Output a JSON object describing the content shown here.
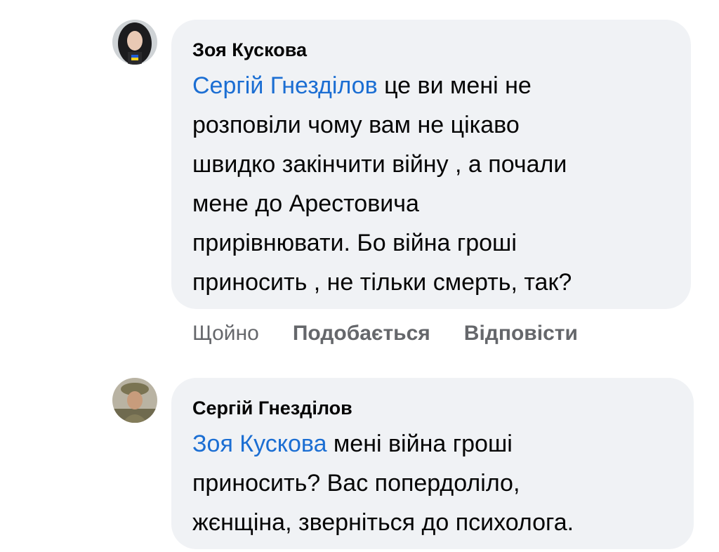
{
  "comments": [
    {
      "author": "Зоя Кускова",
      "mention": "Сергій Гнезділов",
      "lines": [
        " це ви мені не",
        "розповіли чому вам не цікаво",
        "швидко закінчити війну , а почали",
        "мене до Арестовича",
        "прирівнювати. Бо війна гроші",
        "приносить , не тільки смерть, так?"
      ],
      "time": "Щойно",
      "like_label": "Подобається",
      "reply_label": "Відповісти"
    },
    {
      "author": "Сергій Гнезділов",
      "mention": "Зоя Кускова",
      "lines": [
        " мені війна гроші",
        "приносить? Вас попердоліло,",
        "жєнщіна, зверніться до психолога."
      ]
    }
  ],
  "colors": {
    "bubble": "#f0f2f5",
    "mention": "#1b6ed3",
    "meta": "#65676b"
  }
}
